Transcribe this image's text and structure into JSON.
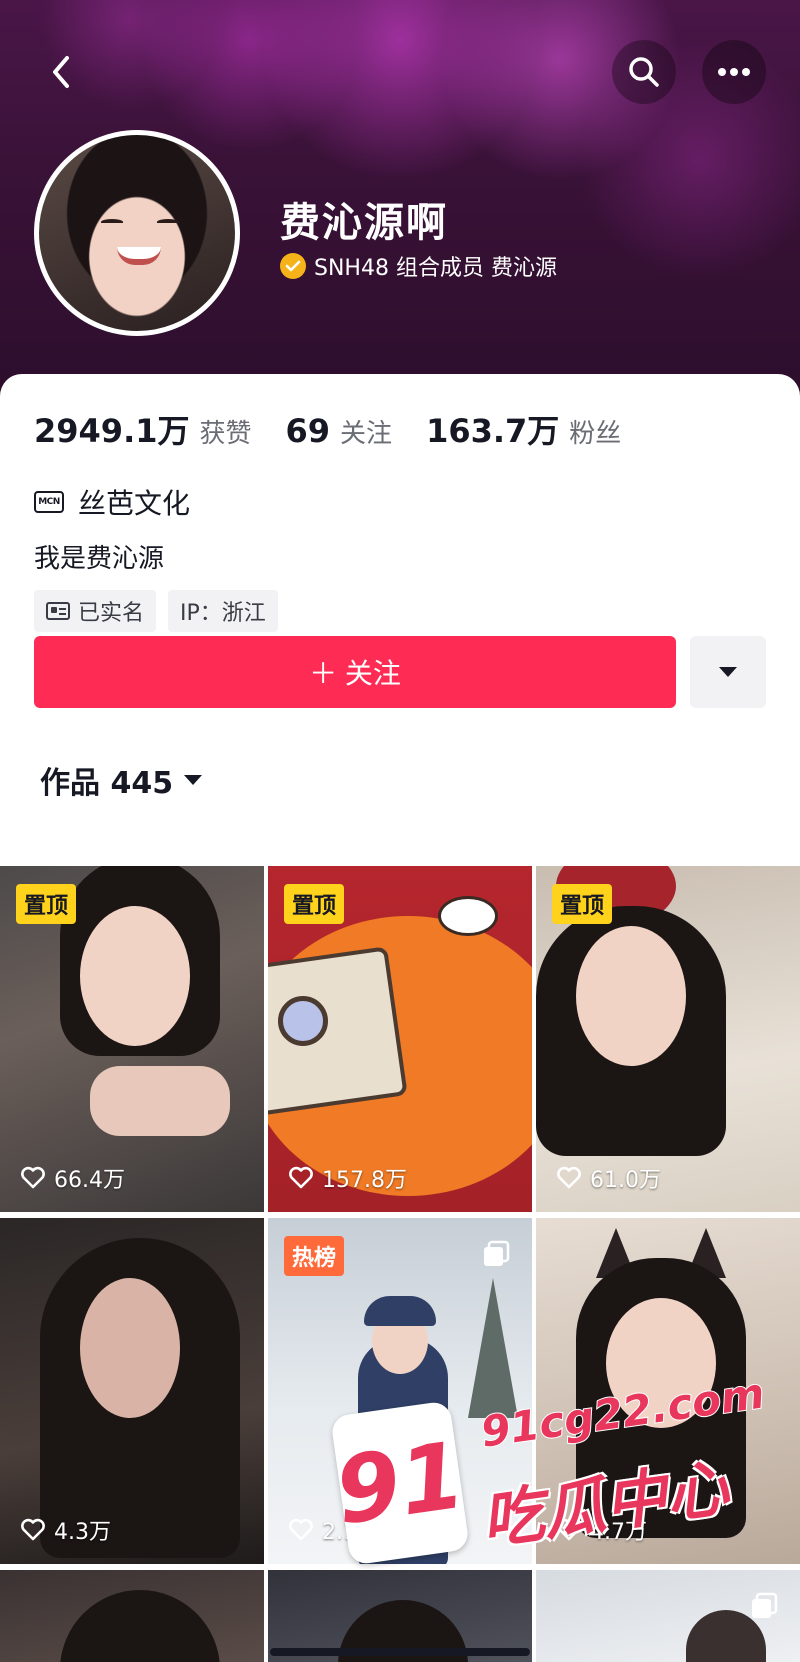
{
  "header": {
    "nickname": "费沁源啊",
    "verification": "SNH48 组合成员 费沁源"
  },
  "stats": [
    {
      "value": "2949.1万",
      "label": "获赞"
    },
    {
      "value": "69",
      "label": "关注"
    },
    {
      "value": "163.7万",
      "label": "粉丝"
    }
  ],
  "profile": {
    "mcn_badge": "MCN",
    "mcn_name": "丝芭文化",
    "bio": "我是费沁源",
    "tags": [
      "已实名",
      "IP：浙江"
    ]
  },
  "actions": {
    "follow_label": "＋ 关注"
  },
  "works": {
    "tab_label": "作品 445"
  },
  "videos": [
    {
      "likes": "66.4万",
      "badge": "置顶"
    },
    {
      "likes": "157.8万",
      "badge": "置顶"
    },
    {
      "likes": "61.0万",
      "badge": "置顶"
    },
    {
      "likes": "4.3万",
      "badge": ""
    },
    {
      "likes": "2.1万",
      "badge": "热榜"
    },
    {
      "likes": "4.7万",
      "badge": ""
    }
  ],
  "watermark": {
    "number": "91",
    "url": "91cg22.com",
    "text": "吃瓜中心"
  },
  "colors": {
    "follow_red": "#fe2c55",
    "verify_gold": "#f6b319",
    "pin_yellow": "#ffd21c",
    "hot_orange": "#ff6a3a"
  },
  "icons": [
    "back-arrow-icon",
    "search-icon",
    "more-icon",
    "verified-icon",
    "mcn-icon",
    "id-card-icon",
    "caret-down-icon",
    "heart-icon",
    "multi-image-icon"
  ]
}
